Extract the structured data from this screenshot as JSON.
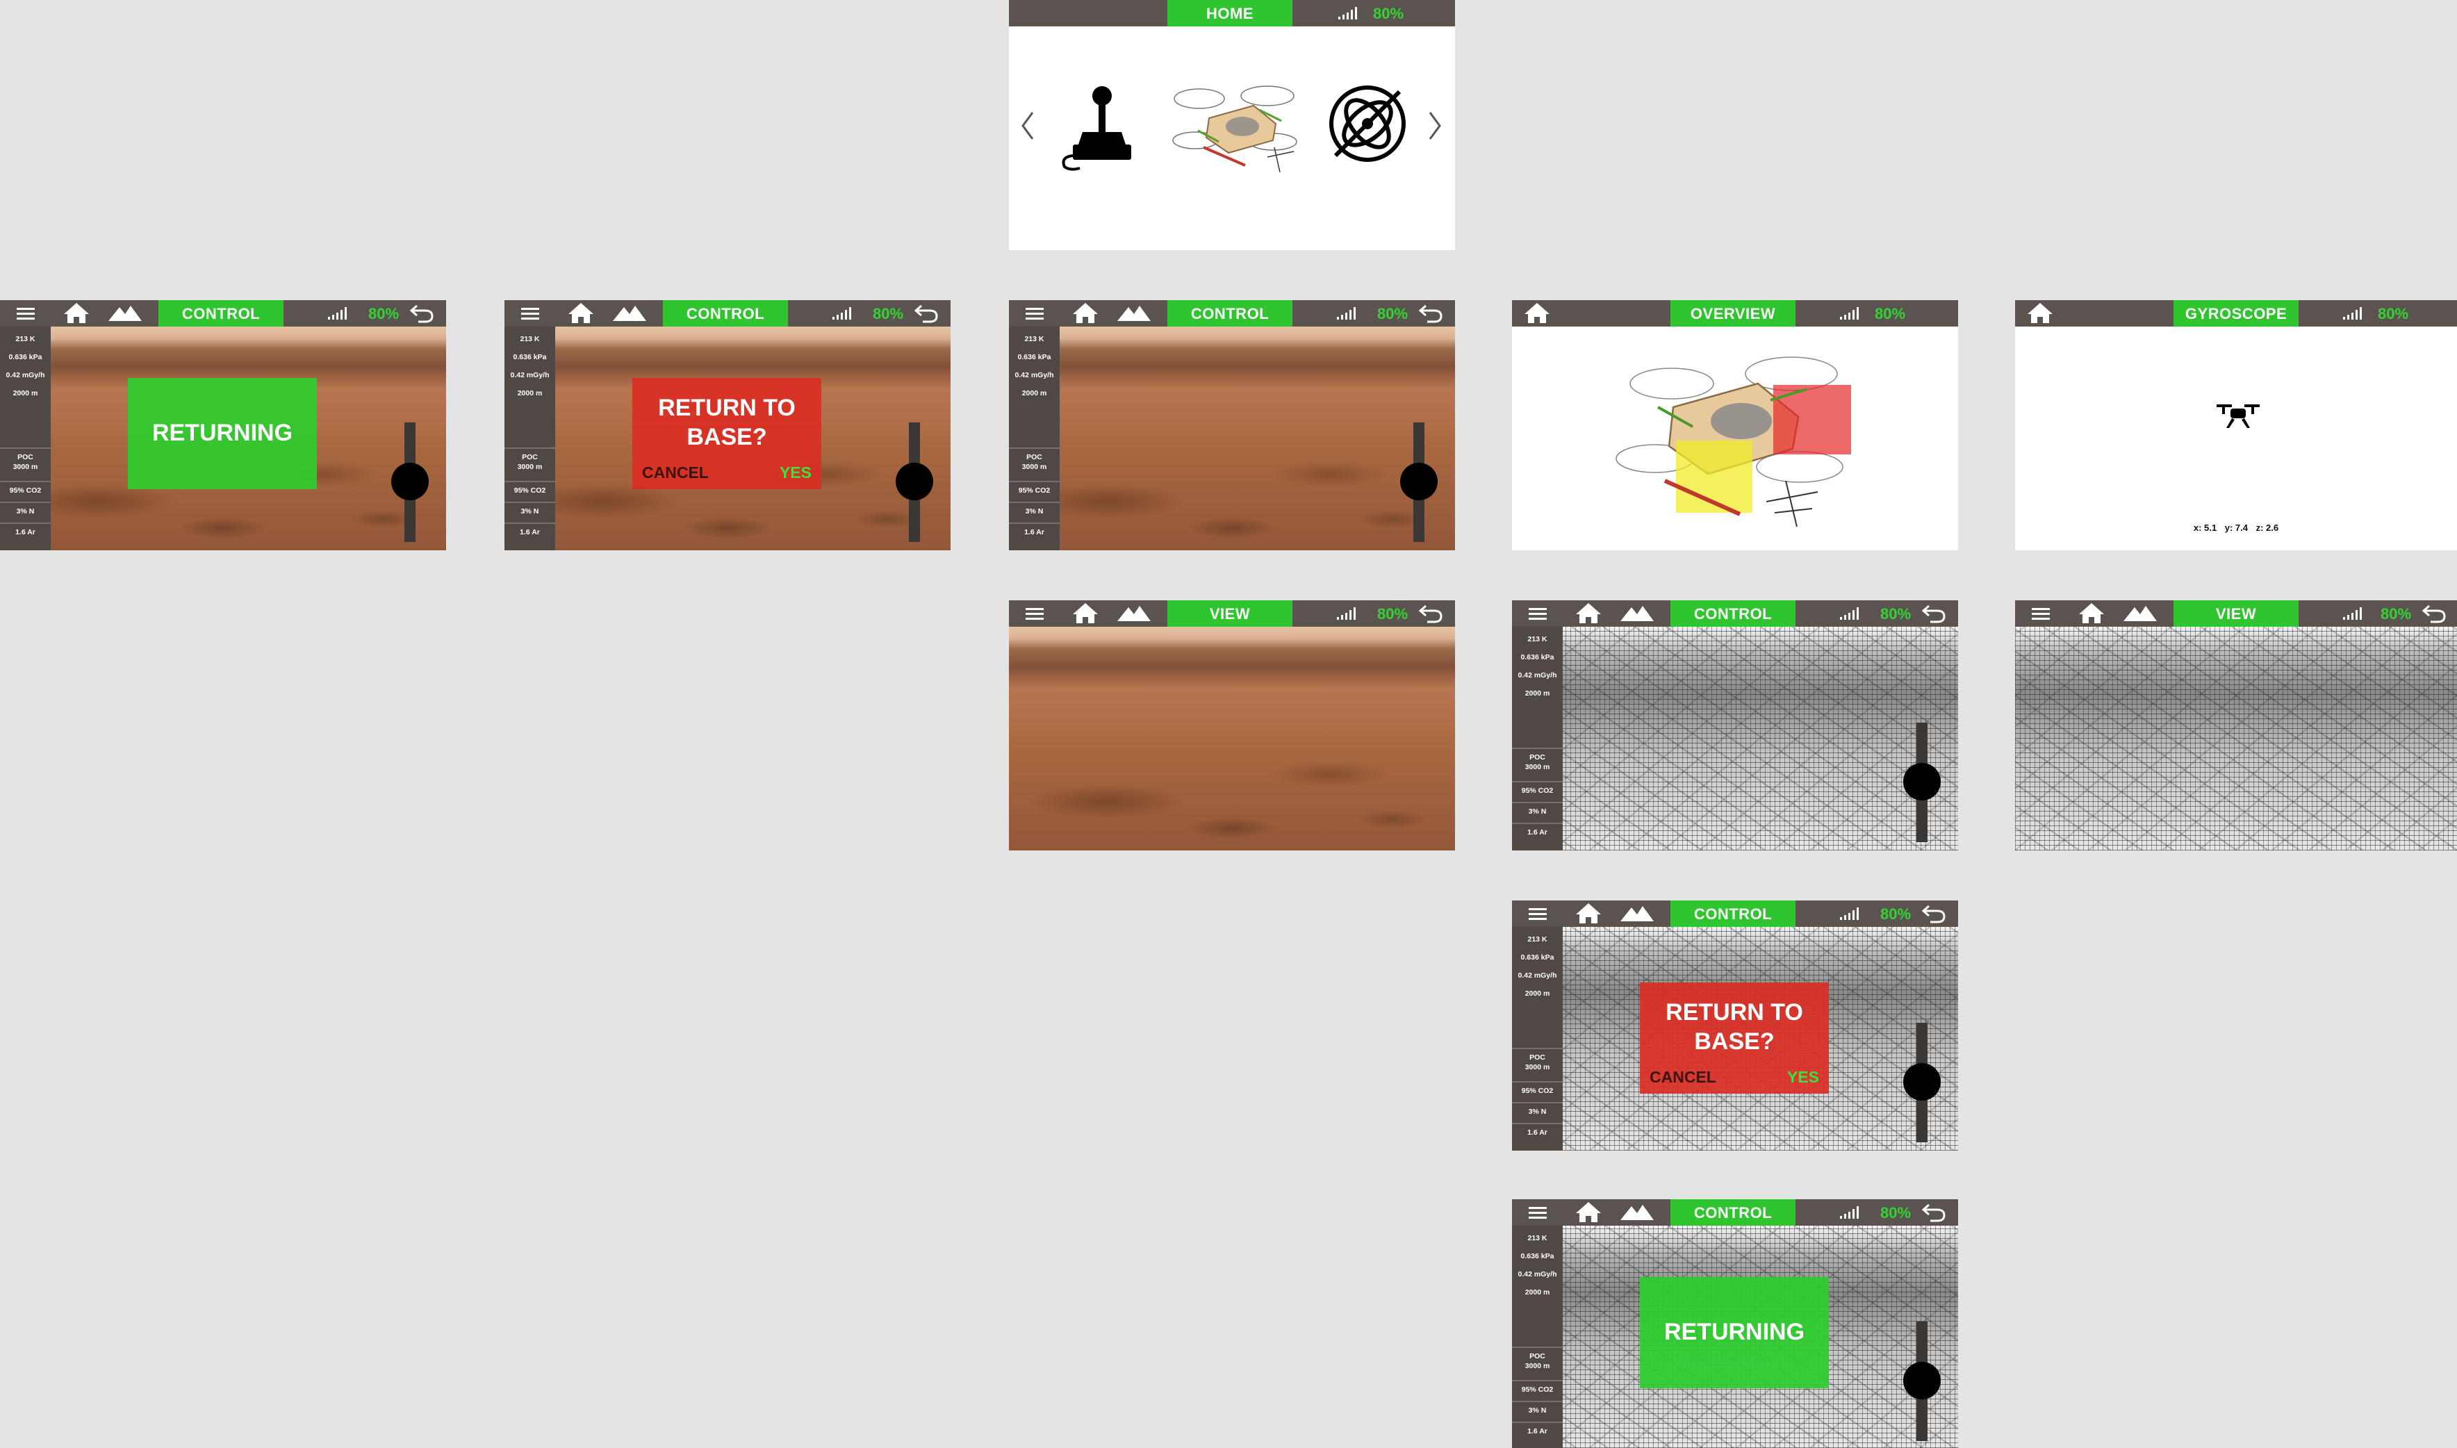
{
  "battery": "80%",
  "home_screen": {
    "title": "HOME",
    "icons": [
      "joystick-icon",
      "drone-model-image",
      "gyroscope-icon"
    ],
    "nav": [
      "chevron-left-icon",
      "chevron-right-icon"
    ]
  },
  "control": {
    "title": "CONTROL",
    "sensors": {
      "temperature": "213 K",
      "pressure": "0.636 kPa",
      "radiation": "0.42 mGy/h",
      "altitude": "2000 m",
      "poc_label": "POC",
      "poc_value": "3000 m",
      "co2": "95% CO2",
      "nitrogen": "3% N",
      "argon": "1.6 Ar"
    }
  },
  "dialogs": {
    "returning": "RETURNING",
    "return_line1": "RETURN TO",
    "return_line2": "BASE?",
    "cancel": "CANCEL",
    "yes": "YES"
  },
  "view": {
    "title": "VIEW"
  },
  "overview": {
    "title": "OVERVIEW"
  },
  "gyroscope": {
    "title": "GYROSCOPE",
    "x": "x: 5.1",
    "y": "y: 7.4",
    "z": "z: 2.6"
  },
  "icons": [
    "menu-icon",
    "home-icon",
    "terrain-icon",
    "signal-icon",
    "back-icon"
  ],
  "colors": {
    "bar": "#5a5350",
    "accent": "#2ec52e",
    "danger": "#da2e24",
    "sidebar": "#504844"
  }
}
